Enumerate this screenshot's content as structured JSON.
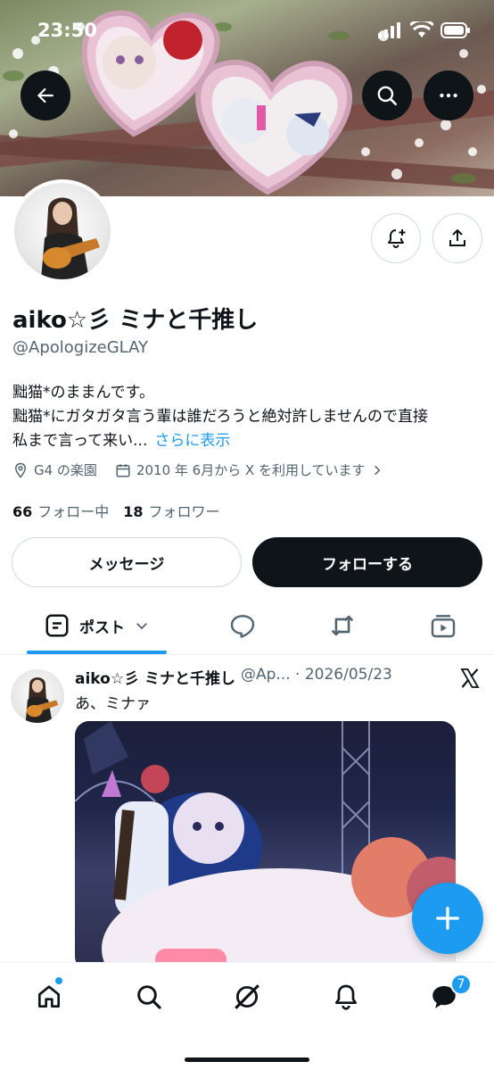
{
  "status_bar": {
    "time": "23:50"
  },
  "banner": {
    "description_icons": [
      "back-arrow-icon",
      "search-icon",
      "more-icon"
    ]
  },
  "profile": {
    "name": "aiko☆彡 ミナと千推し",
    "handle": "@ApologizeGLAY",
    "bio_line1": "黜猫*のままんです。",
    "bio_line2": "黜猫*にガタガタ言う輩は誰だろうと絶対許しませんので直接",
    "bio_line3": "私まで言って来い...",
    "bio_more": "さらに表示",
    "location": "G4 の楽園",
    "joined": "2010 年 6月から X を利用しています",
    "following_count": "66",
    "following_label": "フォロー中",
    "followers_count": "18",
    "followers_label": "フォロワー"
  },
  "actions": {
    "message_label": "メッセージ",
    "follow_label": "フォローする"
  },
  "tabs": {
    "posts_label": "ポスト"
  },
  "tweet": {
    "name": "aiko☆彡 ミナと千推し",
    "handle_date": "@Ap... · 2026/05/23",
    "text": "あ、ミナァ"
  },
  "bottom_nav": {
    "messages_badge": "7"
  },
  "colors": {
    "accent": "#1d9bf0",
    "text": "#0f1419",
    "secondary": "#536471"
  }
}
